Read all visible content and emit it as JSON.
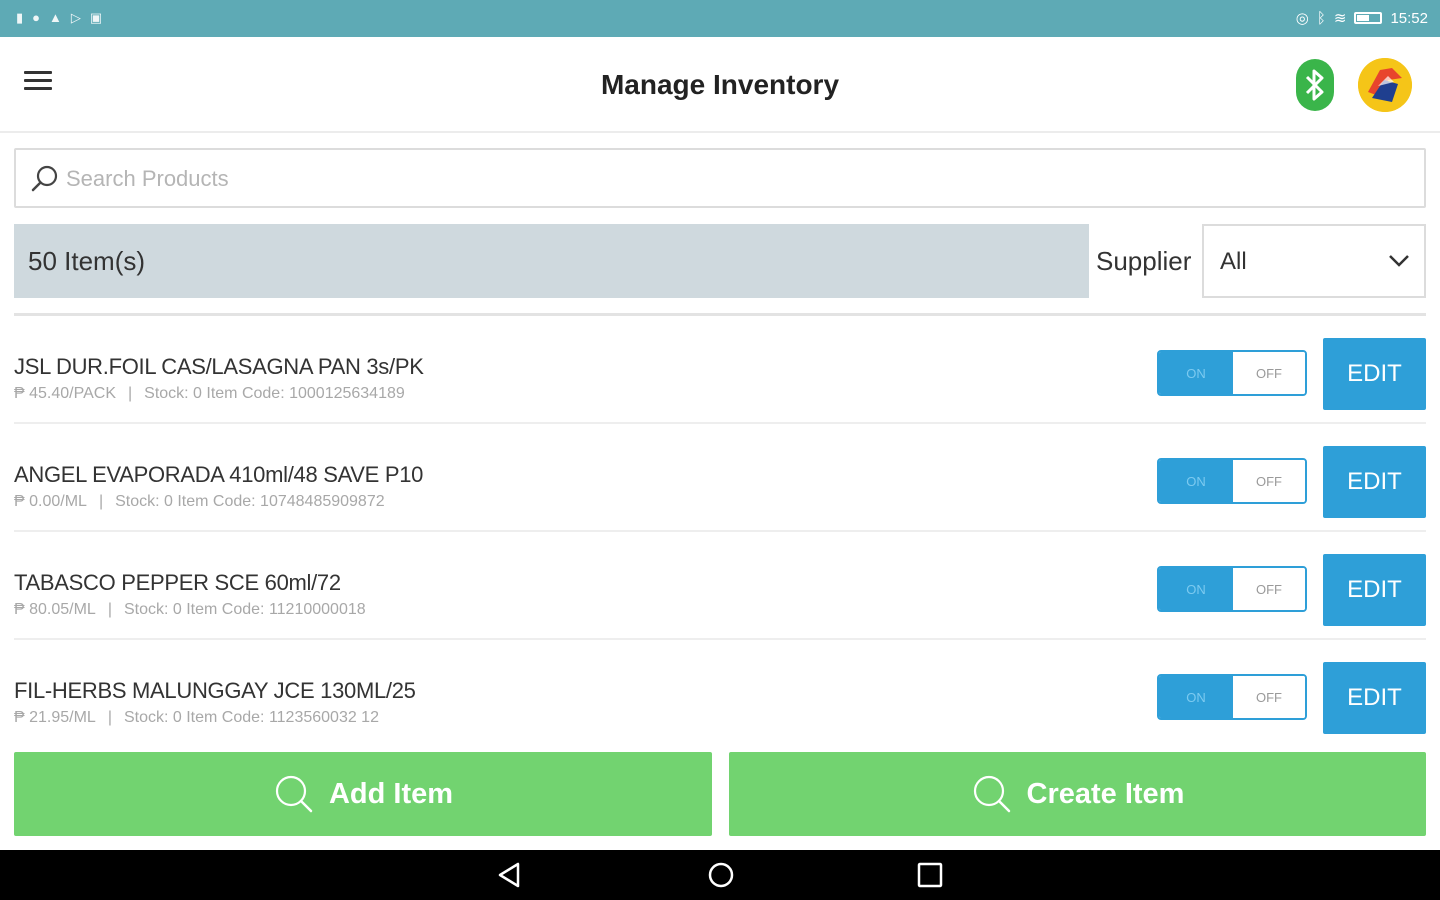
{
  "status_bar": {
    "time": "15:52",
    "left_icons": [
      "notification-icon",
      "message-icon",
      "warning-icon",
      "play-icon",
      "image-icon"
    ],
    "right_icons": [
      "location-icon",
      "bluetooth-icon",
      "wifi-icon",
      "battery-icon"
    ]
  },
  "app_bar": {
    "title": "Manage Inventory"
  },
  "search": {
    "placeholder": "Search Products",
    "value": ""
  },
  "filter": {
    "item_count": "50 Item(s)",
    "supplier_label": "Supplier",
    "supplier_value": "All"
  },
  "colors": {
    "status_bar": "#5eaab5",
    "accent_blue": "#2e9fd8",
    "accent_green": "#72d370",
    "bluetooth_green": "#3ab54a",
    "count_bar": "#cfd9de"
  },
  "products": [
    {
      "name": "JSL DUR.FOIL CAS/LASAGNA PAN 3s/PK",
      "price": "₱ 45.40/PACK",
      "stock": "Stock: 0 Item Code: 1000125634189",
      "toggle_on": "ON",
      "toggle_off": "OFF",
      "edit": "EDIT"
    },
    {
      "name": "ANGEL EVAPORADA 410ml/48 SAVE P10",
      "price": "₱ 0.00/ML",
      "stock": "Stock: 0 Item Code: 10748485909872",
      "toggle_on": "ON",
      "toggle_off": "OFF",
      "edit": "EDIT"
    },
    {
      "name": "TABASCO PEPPER SCE 60ml/72",
      "price": "₱ 80.05/ML",
      "stock": "Stock: 0 Item Code: 11210000018",
      "toggle_on": "ON",
      "toggle_off": "OFF",
      "edit": "EDIT"
    },
    {
      "name": "FIL-HERBS MALUNGGAY JCE 130ML/25",
      "price": "₱ 21.95/ML",
      "stock": "Stock: 0 Item Code: 1123560032 12",
      "toggle_on": "ON",
      "toggle_off": "OFF",
      "edit": "EDIT"
    }
  ],
  "actions": {
    "add_item": "Add Item",
    "create_item": "Create Item"
  },
  "nav": {
    "icons": [
      "back-icon",
      "home-icon",
      "recent-apps-icon"
    ]
  }
}
